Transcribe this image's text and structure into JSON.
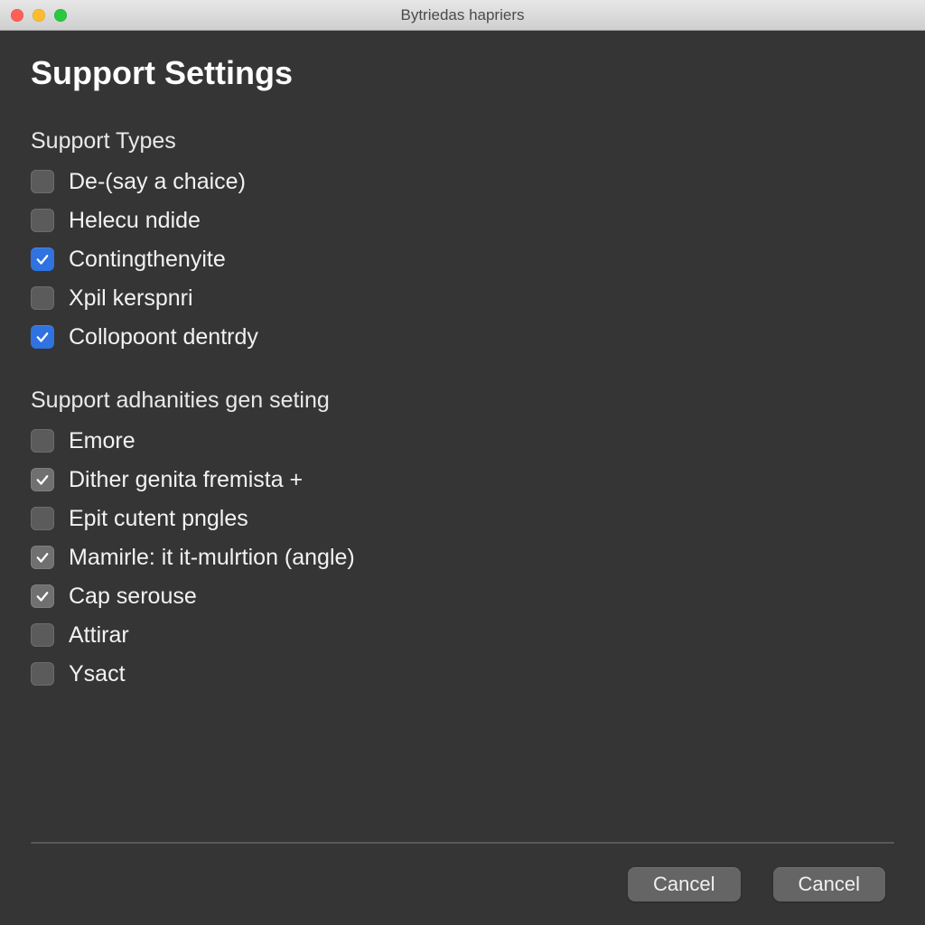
{
  "window": {
    "title": "Bytriedas hapriers"
  },
  "page": {
    "title": "Support Settings"
  },
  "sections": [
    {
      "title": "Support Types",
      "options": [
        {
          "label": "De-(say a chaice)",
          "checked": false,
          "style": "unchecked"
        },
        {
          "label": "Helecu ndide",
          "checked": false,
          "style": "unchecked"
        },
        {
          "label": "Contingthenyite",
          "checked": true,
          "style": "blue"
        },
        {
          "label": "Xpil kerspnri",
          "checked": false,
          "style": "unchecked"
        },
        {
          "label": "Collopoont dentrdy",
          "checked": true,
          "style": "blue"
        }
      ]
    },
    {
      "title": "Support adhanities gen seting",
      "options": [
        {
          "label": "Emore",
          "checked": false,
          "style": "unchecked"
        },
        {
          "label": "Dither genita fremista +",
          "checked": true,
          "style": "grey-checked"
        },
        {
          "label": "Epit cutent pngles",
          "checked": false,
          "style": "unchecked"
        },
        {
          "label": "Mamirle: it it-mulrtion (angle)",
          "checked": true,
          "style": "grey-checked"
        },
        {
          "label": "Cap serouse",
          "checked": true,
          "style": "grey-checked"
        },
        {
          "label": "Attirar",
          "checked": false,
          "style": "unchecked"
        },
        {
          "label": "Ysact",
          "checked": false,
          "style": "unchecked"
        }
      ]
    }
  ],
  "footer": {
    "button_left": "Cancel",
    "button_right": "Cancel"
  }
}
